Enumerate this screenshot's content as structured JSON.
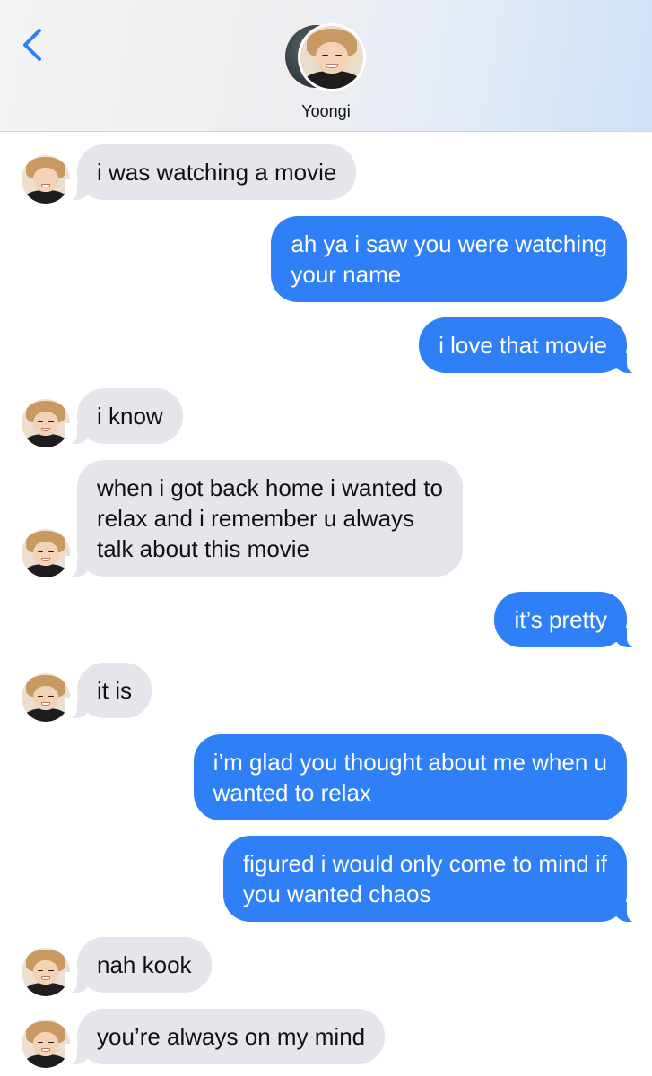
{
  "header": {
    "contact_name": "Yoongi",
    "back_icon": "chevron-left-icon",
    "accent_color": "#2f80f6"
  },
  "messages": [
    {
      "sender": "contact",
      "text": "i was watching a movie"
    },
    {
      "sender": "me",
      "text": "ah ya i saw you were watching\nyour name"
    },
    {
      "sender": "me",
      "text": "i love that movie"
    },
    {
      "sender": "contact",
      "text": "i know"
    },
    {
      "sender": "contact",
      "text": "when i got back home i wanted to\nrelax and i remember u always\ntalk about this movie"
    },
    {
      "sender": "me",
      "text": "it’s pretty"
    },
    {
      "sender": "contact",
      "text": "it is"
    },
    {
      "sender": "me",
      "text": "i’m glad you thought about me when u\nwanted to relax"
    },
    {
      "sender": "me",
      "text": "figured i would only come to mind if\nyou wanted chaos"
    },
    {
      "sender": "contact",
      "text": "nah kook"
    },
    {
      "sender": "contact",
      "text": "you’re always on my mind"
    }
  ],
  "colors": {
    "incoming_bubble": "#e6e5eb",
    "outgoing_bubble": "#2f80f6"
  }
}
